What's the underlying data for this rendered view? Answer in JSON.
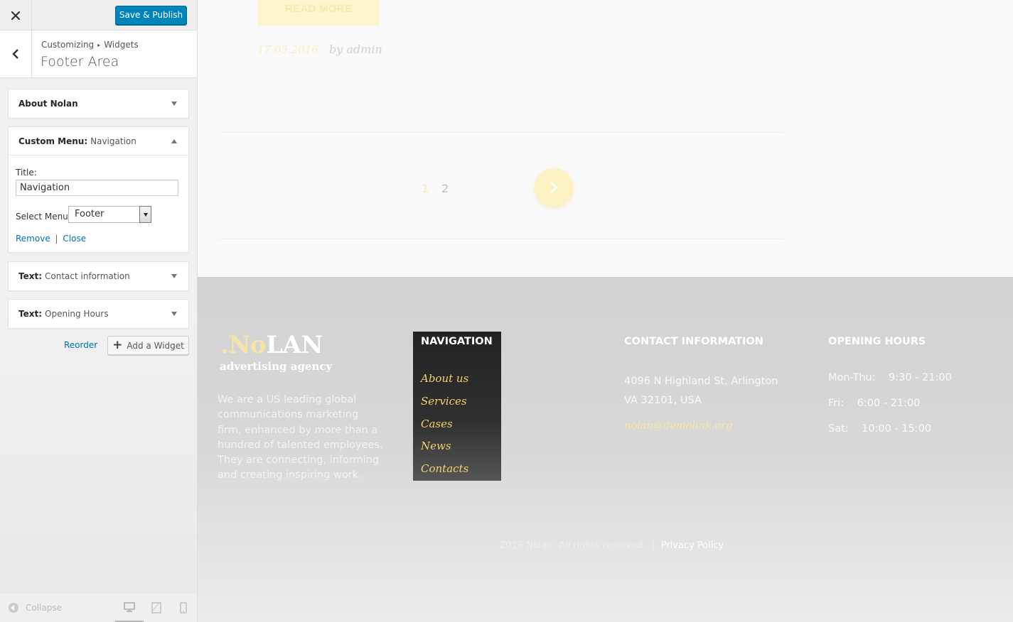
{
  "sidebar": {
    "save_label": "Save & Publish",
    "breadcrumb": {
      "root": "Customizing",
      "current": "Widgets"
    },
    "title": "Footer Area",
    "widgets": [
      {
        "title": "About Nolan",
        "subtitle": ""
      },
      {
        "title": "Custom Menu:",
        "subtitle": "Navigation"
      },
      {
        "title": "Text:",
        "subtitle": "Contact information"
      },
      {
        "title": "Text:",
        "subtitle": "Opening Hours"
      }
    ],
    "nav_form": {
      "title_label": "Title:",
      "title_value": "Navigation",
      "menu_label": "Select Menu:",
      "menu_value": "Footer",
      "remove_label": "Remove",
      "separator": "|",
      "close_label": "Close"
    },
    "reorder_label": "Reorder",
    "add_widget_label": "Add a Widget",
    "collapse_label": "Collapse"
  },
  "preview": {
    "read_more": "READ MORE",
    "post_date": "17.05.2016",
    "post_author": "by admin",
    "pagination": [
      "1",
      "2"
    ],
    "footer": {
      "logo": {
        "part1": ".No",
        "part2": "LAN"
      },
      "tagline": "advertising agency",
      "about_text": "We are a US leading global communications marketing firm, enhanced by more than a hundred of talented employees. They are connecting, informing and creating inspiring work.",
      "nav_heading": "NAVIGATION",
      "nav_links": [
        "About us",
        "Services",
        "Cases",
        "News",
        "Contacts"
      ],
      "contact_heading": "CONTACT INFORMATION",
      "contact_address_1": "4096 N Highland St, Arlington",
      "contact_address_2": "VA 32101, USA",
      "contact_email": "nolan@demolink.org",
      "hours_heading": "OPENING HOURS",
      "hours": [
        "Mon-Thu:    9:30 - 21:00",
        "Fri:    6:00 - 21:00",
        "Sat:    10:00 - 15:00"
      ],
      "copyright": "2016 Nolan. All rights reserved.",
      "copyright_sep": "|",
      "privacy_label": "Privacy Policy"
    }
  },
  "colors": {
    "primary_button": "#0085ba",
    "link": "#0073aa",
    "accent_yellow": "#f2d26b",
    "footer_bg": "#d2d2d2"
  }
}
